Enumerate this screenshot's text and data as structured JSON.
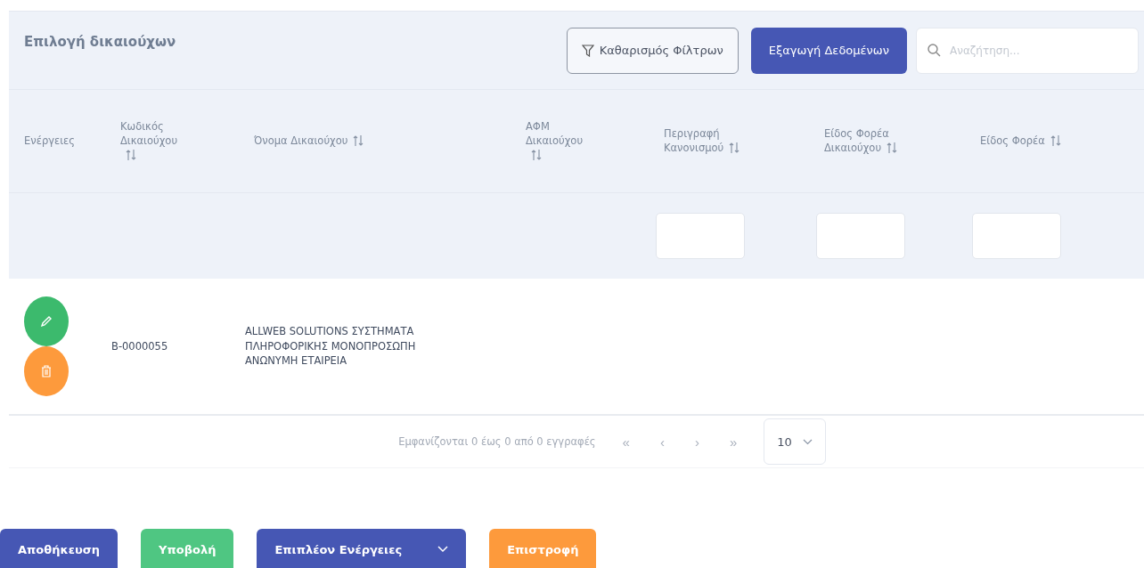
{
  "panel": {
    "title": "Επιλογή δικαιούχων",
    "clear_filters": "Καθαρισμός Φίλτρων",
    "export": "Εξαγωγή Δεδομένων",
    "search": {
      "placeholder": "Αναζήτηση..."
    }
  },
  "table": {
    "columns": [
      {
        "label": "Ενέργειες",
        "sortable": false,
        "filter": false
      },
      {
        "label": "Κωδικός Δικαιούχου",
        "sortable": true,
        "filter": false
      },
      {
        "label": "Όνομα Δικαιούχου",
        "sortable": true,
        "filter": false
      },
      {
        "label": "ΑΦΜ Δικαιούχου",
        "sortable": true,
        "filter": false
      },
      {
        "label": "Περιγραφή Κανονισμού",
        "sortable": true,
        "filter": true
      },
      {
        "label": "Είδος Φορέα Δικαιούχου",
        "sortable": true,
        "filter": true
      },
      {
        "label": "Είδος Φορέα",
        "sortable": true,
        "filter": true
      }
    ],
    "rows": [
      {
        "cells": [
          "",
          "B-0000055",
          "ALLWEB SOLUTIONS ΣΥΣΤΗΜΑΤΑ ΠΛΗΡΟΦΟΡΙΚΗΣ ΜΟΝΟΠΡΟΣΩΠΗ ΑΝΩΝΥΜΗ ΕΤΑΙΡΕΙΑ",
          "",
          "",
          "",
          ""
        ]
      }
    ]
  },
  "pagination": {
    "info": "Εμφανίζονται 0 έως 0 από 0 εγγραφές",
    "nav": [
      "«",
      "‹",
      "›",
      "»"
    ],
    "page_size": "10"
  },
  "buttons": [
    {
      "label": "Αποθήκευση",
      "kind": "primary",
      "menu": false
    },
    {
      "label": "Υποβολή",
      "kind": "success",
      "menu": false
    },
    {
      "label": "Επιπλέον Ενέργειες",
      "kind": "primary",
      "menu": true
    },
    {
      "label": "Επιστροφή",
      "kind": "warning",
      "menu": false
    }
  ]
}
